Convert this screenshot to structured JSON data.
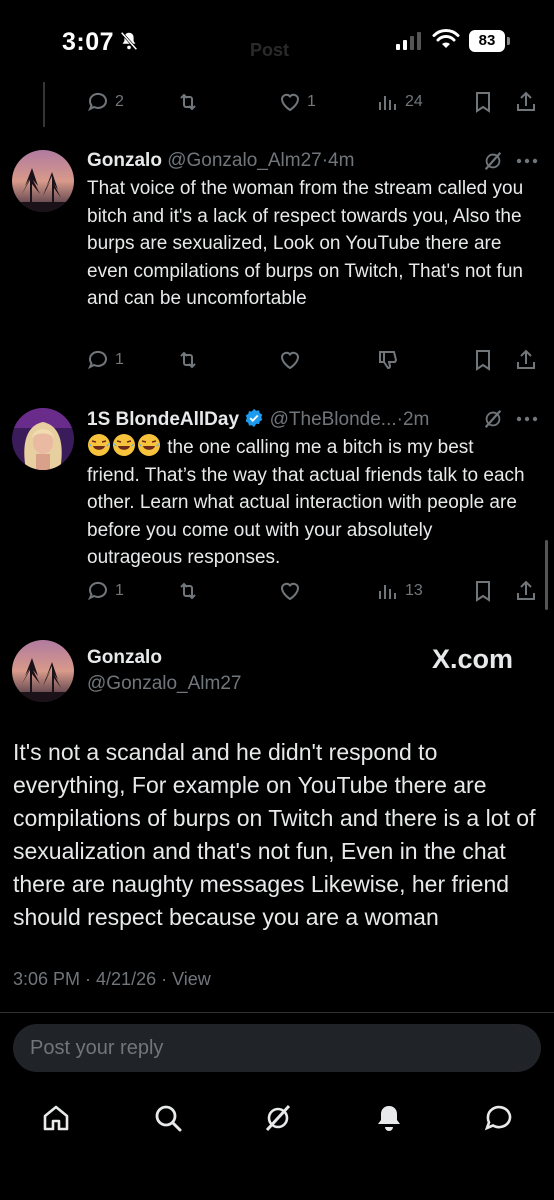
{
  "status_bar": {
    "time": "3:07",
    "battery": "83",
    "faded_title": "Post"
  },
  "top_actions": {
    "replies": "2",
    "reposts": "",
    "likes": "1",
    "views": "24"
  },
  "tweet1": {
    "name": "Gonzalo",
    "handle": "@Gonzalo_Alm27",
    "dot": "·",
    "time": "4m",
    "text": "That voice of the woman from the stream called you bitch and it's a lack of respect towards you, Also the burps are sexualized, Look on YouTube there are even compilations of burps on Twitch, That's not fun and can be uncomfortable",
    "actions": {
      "replies": "1"
    }
  },
  "tweet2": {
    "name": "1S BlondeAllDay",
    "handle": "@TheBlonde...",
    "dot": "·",
    "time": "2m",
    "text": " the one calling me a bitch is my best friend. That’s the way that actual friends talk to each other. Learn what actual interaction with people are before you come out with your absolutely outrageous responses.",
    "actions": {
      "replies": "1",
      "views": "13"
    }
  },
  "main_tweet": {
    "name": "Gonzalo",
    "handle": "@Gonzalo_Alm27",
    "watermark": "X.com",
    "text": "It's not a scandal and he didn't respond to everything, For example on YouTube there are compilations of burps on Twitch and there is a lot of sexualization and that's not fun, Even in the chat there are naughty messages Likewise, her friend should respect because you are a woman",
    "meta": "3:06 PM · 4/21/26 · View"
  },
  "reply": {
    "placeholder": "Post your reply"
  },
  "colors": {
    "background": "#000000",
    "text": "#e7e9ea",
    "muted": "#71767b",
    "verified": "#1d9bf0"
  }
}
